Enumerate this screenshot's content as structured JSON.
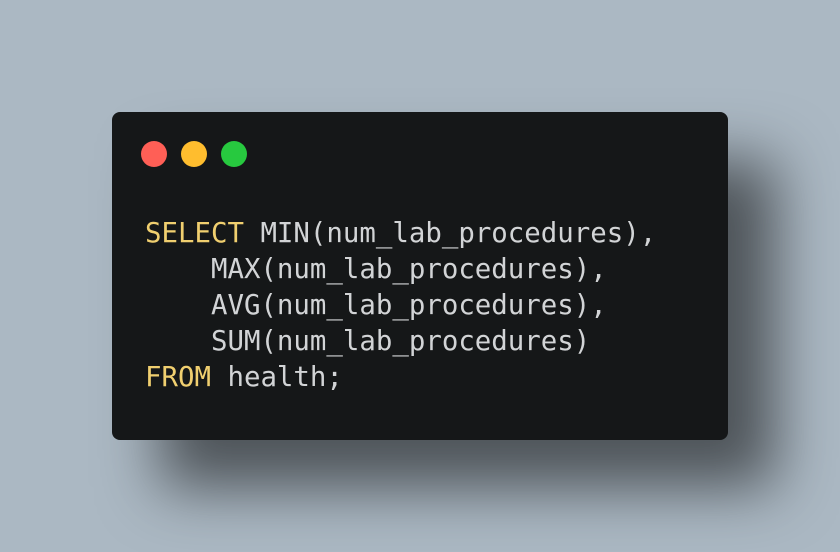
{
  "colors": {
    "background": "#abb8c3",
    "window": "#151718",
    "text": "#d2d4d6",
    "keyword": "#f0cf6f",
    "close": "#ff5f56",
    "minimize": "#ffbd2e",
    "maximize": "#27c93f"
  },
  "window_controls": [
    {
      "icon": "close-dot-icon",
      "color": "#ff5f56"
    },
    {
      "icon": "minimize-dot-icon",
      "color": "#ffbd2e"
    },
    {
      "icon": "maximize-dot-icon",
      "color": "#27c93f"
    }
  ],
  "code": {
    "language": "SQL",
    "lines": [
      {
        "keyword": "SELECT",
        "text": " MIN(num_lab_procedures),"
      },
      {
        "keyword": "",
        "text": "    MAX(num_lab_procedures),"
      },
      {
        "keyword": "",
        "text": "    AVG(num_lab_procedures),"
      },
      {
        "keyword": "",
        "text": "    SUM(num_lab_procedures)"
      },
      {
        "keyword": "FROM",
        "text": " health;"
      }
    ]
  }
}
